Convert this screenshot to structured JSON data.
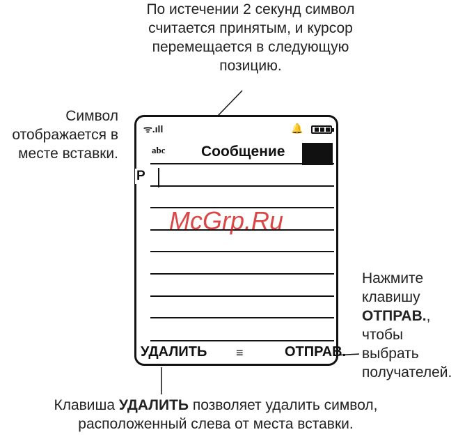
{
  "callouts": {
    "top": [
      "По истечении 2 секунд символ",
      "считается принятым, и курсор",
      "перемещается в следующую",
      "позицию."
    ],
    "left": [
      "Символ",
      "отображается в",
      "месте вставки."
    ],
    "right_line1": "Нажмите",
    "right_line2": "клавишу",
    "right_key": "ОТПРАВ.",
    "right_after_key": ", чтобы",
    "right_line4": "выбрать",
    "right_line5": "получателей.",
    "bottom_prefix": "Клавиша ",
    "bottom_key": "УДАЛИТЬ",
    "bottom_suffix": " позволяет удалить символ,",
    "bottom_line2": "расположенный слева от места вставки."
  },
  "phone": {
    "signal_icon": "signal-strength-icon",
    "alert_icon": "ring-alert-icon",
    "battery_icon": "battery-icon",
    "mode": "abc",
    "title": "Сообщение",
    "entered_char": "P",
    "softkey_left": "УДАЛИТЬ",
    "menu_icon": "≡",
    "softkey_right": "ОТПРАВ."
  },
  "watermark": "McGrp.Ru",
  "colors": {
    "watermark": "#d21919",
    "ink": "#111111"
  }
}
